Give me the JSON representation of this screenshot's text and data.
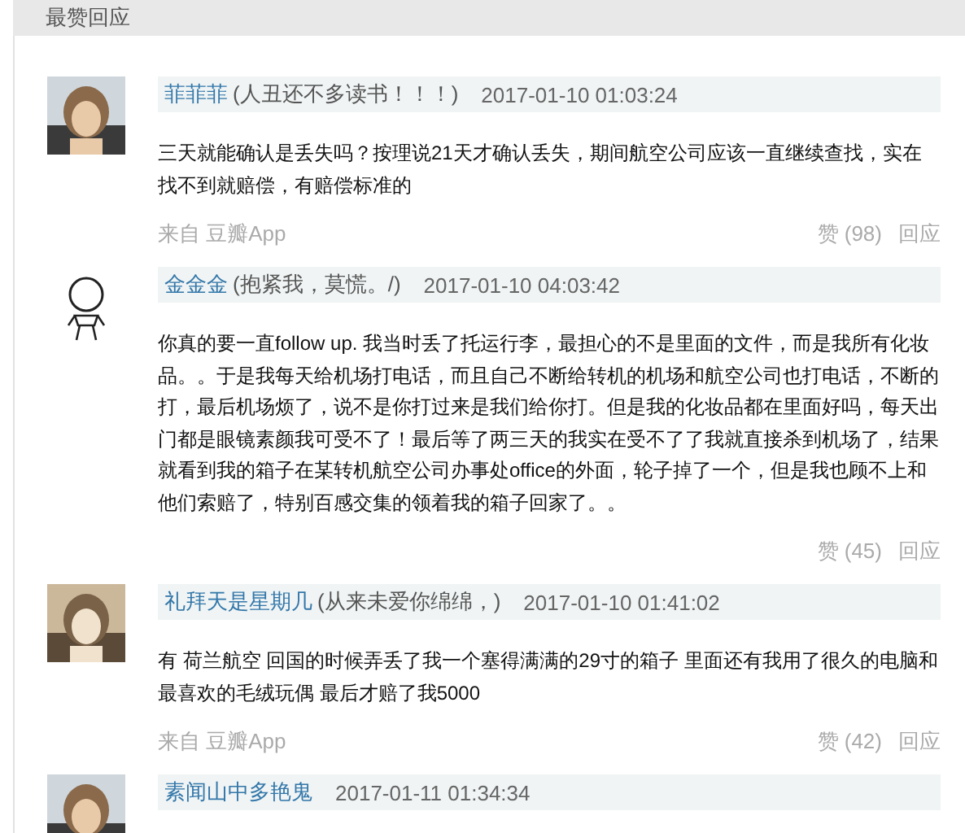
{
  "section_title": "最赞回应",
  "comments": [
    {
      "kind": "picture",
      "name": "菲菲菲",
      "signature": "(人丑还不多读书！！！)",
      "time": "2017-01-10 01:03:24",
      "text": "三天就能确认是丢失吗？按理说21天才确认丢失，期间航空公司应该一直继续查找，实在找不到就赔偿，有赔偿标准的",
      "source": "来自 豆瓣App",
      "likes": "赞 (98)",
      "reply": "回应"
    },
    {
      "kind": "figure",
      "name": "金金金",
      "signature": "(抱紧我，莫慌。/)",
      "time": "2017-01-10 04:03:42",
      "text": "你真的要一直follow up. 我当时丢了托运行李，最担心的不是里面的文件，而是我所有化妆品。。于是我每天给机场打电话，而且自己不断给转机的机场和航空公司也打电话，不断的打，最后机场烦了，说不是你打过来是我们给你打。但是我的化妆品都在里面好吗，每天出门都是眼镜素颜我可受不了！最后等了两三天的我实在受不了了我就直接杀到机场了，结果就看到我的箱子在某转机航空公司办事处office的外面，轮子掉了一个，但是我也顾不上和他们索赔了，特别百感交集的领着我的箱子回家了。。",
      "likes": "赞 (45)",
      "reply": "回应"
    },
    {
      "kind": "picture",
      "name": "礼拜天是星期几",
      "signature": "(从来未爱你绵绵，)",
      "time": "2017-01-10 01:41:02",
      "text": "有 荷兰航空 回国的时候弄丢了我一个塞得满满的29寸的箱子 里面还有我用了很久的电脑和最喜欢的毛绒玩偶 最后才赔了我5000",
      "source": "来自 豆瓣App",
      "likes": "赞 (42)",
      "reply": "回应"
    },
    {
      "kind": "picture",
      "name": "素闻山中多艳鬼",
      "time": "2017-01-11 01:34:34"
    }
  ]
}
